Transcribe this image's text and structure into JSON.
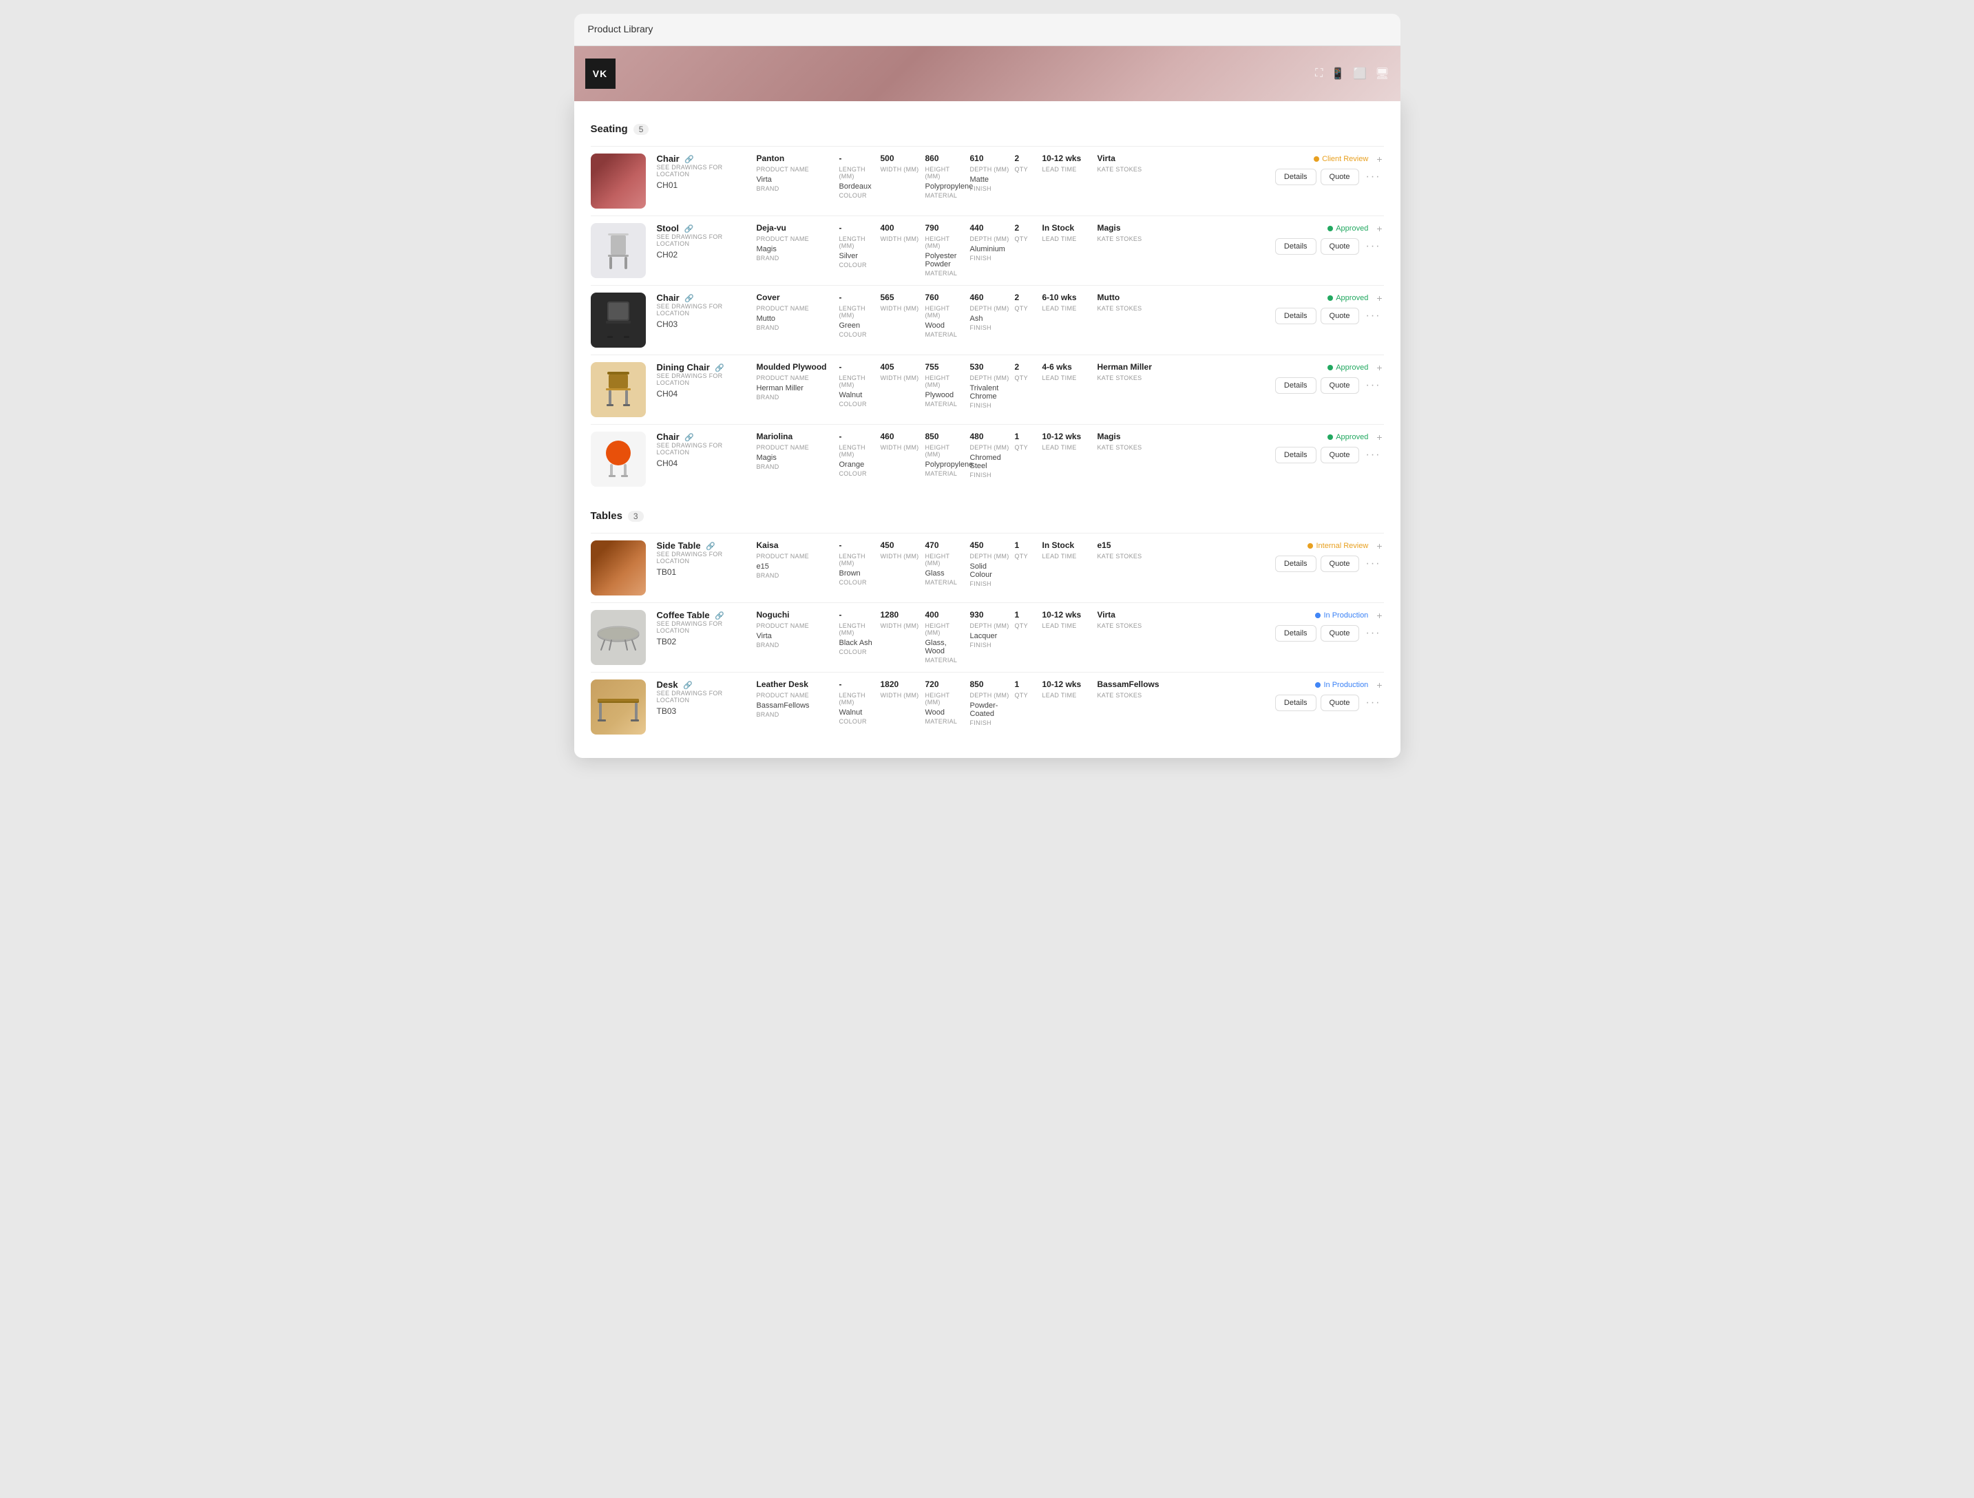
{
  "window": {
    "title": "Product Library"
  },
  "logo": "VK",
  "sections": [
    {
      "id": "seating",
      "label": "Seating",
      "count": 5,
      "items": [
        {
          "id": "CH01",
          "type": "Chair",
          "sublabel": "SEE DRAWINGS FOR LOCATION",
          "code": "CH01",
          "product_name": "Panton",
          "brand": "Virta",
          "length": "-",
          "width": "500",
          "height": "860",
          "depth": "610",
          "qty": "2",
          "lead_time": "10-12 wks",
          "colour": "Bordeaux",
          "material": "Polypropylene",
          "finish": "Matte",
          "assignee_name": "Virta",
          "assignee_label": "KATE STOKES",
          "status": "Client Review",
          "status_type": "client-review",
          "img_style": "background: linear-gradient(135deg, #8b3a3a 20%, #c06060 60%, #d48080 100%);"
        },
        {
          "id": "CH02",
          "type": "Stool",
          "sublabel": "SEE DRAWINGS FOR LOCATION",
          "code": "CH02",
          "product_name": "Deja-vu",
          "brand": "Magis",
          "length": "-",
          "width": "400",
          "height": "790",
          "depth": "440",
          "qty": "2",
          "lead_time": "In Stock",
          "colour": "Silver",
          "material": "Polyester Powder",
          "finish": "Aluminium",
          "assignee_name": "Magis",
          "assignee_label": "KATE STOKES",
          "status": "Approved",
          "status_type": "approved",
          "img_style": "background: #e8e8ec;"
        },
        {
          "id": "CH03",
          "type": "Chair",
          "sublabel": "SEE DRAWINGS FOR LOCATION",
          "code": "CH03",
          "product_name": "Cover",
          "brand": "Mutto",
          "length": "-",
          "width": "565",
          "height": "760",
          "depth": "460",
          "qty": "2",
          "lead_time": "6-10 wks",
          "colour": "Green",
          "material": "Wood",
          "finish": "Ash",
          "assignee_name": "Mutto",
          "assignee_label": "KATE STOKES",
          "status": "Approved",
          "status_type": "approved",
          "img_style": "background: #2a2a2a;"
        },
        {
          "id": "CH04-dining",
          "type": "Dining Chair",
          "sublabel": "SEE DRAWINGS FOR LOCATION",
          "code": "CH04",
          "product_name": "Moulded Plywood",
          "brand": "Herman Miller",
          "length": "-",
          "width": "405",
          "height": "755",
          "depth": "530",
          "qty": "2",
          "lead_time": "4-6 wks",
          "colour": "Walnut",
          "material": "Plywood",
          "finish": "Trivalent Chrome",
          "assignee_name": "Herman Miller",
          "assignee_label": "KATE STOKES",
          "status": "Approved",
          "status_type": "approved",
          "img_style": "background: #c8a060;"
        },
        {
          "id": "CH04-magis",
          "type": "Chair",
          "sublabel": "SEE DRAWINGS FOR LOCATION",
          "code": "CH04",
          "product_name": "Mariolina",
          "brand": "Magis",
          "length": "-",
          "width": "460",
          "height": "850",
          "depth": "480",
          "qty": "1",
          "lead_time": "10-12 wks",
          "colour": "Orange",
          "material": "Polypropylene",
          "finish": "Chromed Steel",
          "assignee_name": "Magis",
          "assignee_label": "KATE STOKES",
          "status": "Approved",
          "status_type": "approved",
          "img_style": "background: #f5f5f5;"
        }
      ]
    },
    {
      "id": "tables",
      "label": "Tables",
      "count": 3,
      "items": [
        {
          "id": "TB01",
          "type": "Side Table",
          "sublabel": "SEE DRAWINGS FOR LOCATION",
          "code": "TB01",
          "product_name": "Kaisa",
          "brand": "e15",
          "length": "-",
          "width": "450",
          "height": "470",
          "depth": "450",
          "qty": "1",
          "lead_time": "In Stock",
          "colour": "Brown",
          "material": "Glass",
          "finish": "Solid Colour",
          "assignee_name": "e15",
          "assignee_label": "KATE STOKES",
          "status": "Internal Review",
          "status_type": "internal-review",
          "img_style": "background: linear-gradient(135deg, #8b4513 20%, #c87941 60%, #e0a070 100%);"
        },
        {
          "id": "TB02",
          "type": "Coffee Table",
          "sublabel": "SEE DRAWINGS FOR LOCATION",
          "code": "TB02",
          "product_name": "Noguchi",
          "brand": "Virta",
          "length": "-",
          "width": "1280",
          "height": "400",
          "depth": "930",
          "qty": "1",
          "lead_time": "10-12 wks",
          "colour": "Black Ash",
          "material": "Glass, Wood",
          "finish": "Lacquer",
          "assignee_name": "Virta",
          "assignee_label": "KATE STOKES",
          "status": "In Production",
          "status_type": "in-production",
          "img_style": "background: #d0d0cc;"
        },
        {
          "id": "TB03",
          "type": "Desk",
          "sublabel": "SEE DRAWINGS FOR LOCATION",
          "code": "TB03",
          "product_name": "Leather Desk",
          "brand": "BassamFellows",
          "length": "-",
          "width": "1820",
          "height": "720",
          "depth": "850",
          "qty": "1",
          "lead_time": "10-12 wks",
          "colour": "Walnut",
          "material": "Wood",
          "finish": "Powder-Coated",
          "assignee_name": "BassamFellows",
          "assignee_label": "KATE STOKES",
          "status": "In Production",
          "status_type": "in-production",
          "img_style": "background: linear-gradient(135deg, #c8a060 0%, #d4b070 60%, #e8c890 100%);"
        }
      ]
    }
  ],
  "buttons": {
    "details": "Details",
    "quote": "Quote"
  },
  "labels": {
    "product_name": "PRODUCT NAME",
    "brand": "BRAND",
    "length": "LENGTH (MM)",
    "width": "WIDTH (MM)",
    "height": "HEIGHT (MM)",
    "depth": "DEPTH (MM)",
    "qty": "QTY",
    "lead_time": "LEAD TIME",
    "colour": "COLOUR",
    "material": "MATERIAL",
    "finish": "FINISH"
  }
}
